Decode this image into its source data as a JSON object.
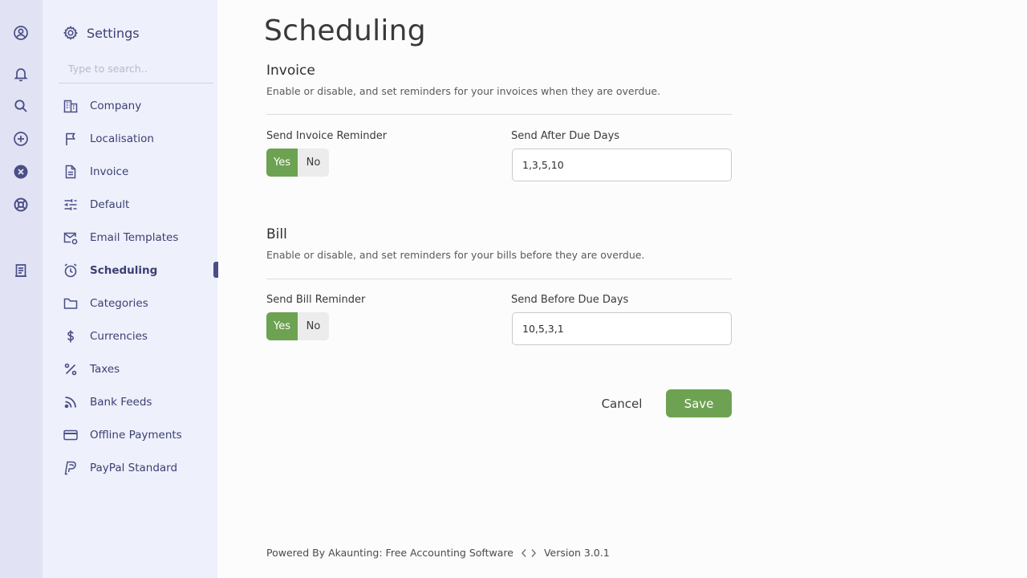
{
  "rail": {
    "icons": [
      "profile-icon",
      "bell-icon",
      "search-icon",
      "add-circle-icon",
      "close-circle-icon",
      "support-icon",
      "receipt-icon"
    ]
  },
  "settings": {
    "title": "Settings",
    "search_placeholder": "Type to search..",
    "items": [
      {
        "label": "Company",
        "icon": "building-icon"
      },
      {
        "label": "Localisation",
        "icon": "flag-icon"
      },
      {
        "label": "Invoice",
        "icon": "document-icon"
      },
      {
        "label": "Default",
        "icon": "sliders-icon"
      },
      {
        "label": "Email Templates",
        "icon": "email-icon"
      },
      {
        "label": "Scheduling",
        "icon": "alarm-icon",
        "active": true
      },
      {
        "label": "Categories",
        "icon": "folder-icon"
      },
      {
        "label": "Currencies",
        "icon": "dollar-icon"
      },
      {
        "label": "Taxes",
        "icon": "percent-icon"
      },
      {
        "label": "Bank Feeds",
        "icon": "rss-icon"
      },
      {
        "label": "Offline Payments",
        "icon": "card-icon"
      },
      {
        "label": "PayPal Standard",
        "icon": "paypal-icon"
      }
    ]
  },
  "page": {
    "title": "Scheduling",
    "invoice": {
      "title": "Invoice",
      "description": "Enable or disable, and set reminders for your invoices when they are overdue.",
      "reminder_label": "Send Invoice Reminder",
      "yes": "Yes",
      "no": "No",
      "reminder_enabled": true,
      "days_label": "Send After Due Days",
      "days_value": "1,3,5,10"
    },
    "bill": {
      "title": "Bill",
      "description": "Enable or disable, and set reminders for your bills before they are overdue.",
      "reminder_label": "Send Bill Reminder",
      "yes": "Yes",
      "no": "No",
      "reminder_enabled": true,
      "days_label": "Send Before Due Days",
      "days_value": "10,5,3,1"
    },
    "cancel_label": "Cancel",
    "save_label": "Save"
  },
  "footer": {
    "powered_by": "Powered By Akaunting: Free Accounting Software",
    "version": "Version 3.0.1"
  },
  "colors": {
    "accent_green": "#6da252",
    "nav_text": "#3c3f72",
    "rail_bg": "#e1e3f5",
    "panel_bg": "#eef0fb"
  }
}
